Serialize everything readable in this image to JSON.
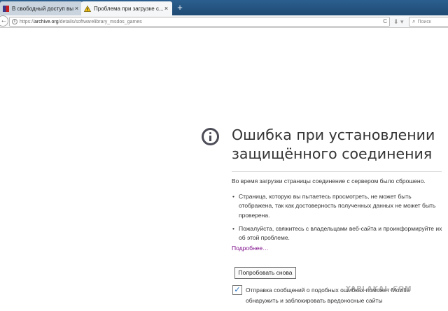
{
  "tabs": [
    {
      "title": "В свободный доступ выл...",
      "active": false,
      "favicon": "site-favicon"
    },
    {
      "title": "Проблема при загрузке с...",
      "active": true,
      "favicon": "warning-icon"
    }
  ],
  "tab_close_glyph": "×",
  "new_tab_glyph": "+",
  "navbar": {
    "back_glyph": "←",
    "url_scheme": "https://",
    "url_host": "archive.org",
    "url_path": "/details/softwarelibrary_msdos_games",
    "reload_glyph": "C",
    "download_glyph": "⬇ ▾",
    "search_placeholder": "Поиск"
  },
  "error": {
    "title_line1": "Ошибка при установлении",
    "title_line2": "защищённого соединения",
    "description": "Во время загрузки страницы соединение с сервером было сброшено.",
    "bullets": [
      "Страница, которую вы пытаетесь просмотреть, не может быть отображена, так как достоверность полученных данных не может быть проверена.",
      "Пожалуйста, свяжитесь с владельцами веб-сайта и проинформируйте их об этой проблеме."
    ],
    "learn_more": "Подробнее…",
    "try_again": "Попробовать снова",
    "report_checked": true,
    "report_text": "Отправка сообщений о подобных ошибках поможет Mozilla обнаружить и заблокировать вредоносные сайты"
  },
  "watermark": "YAPLAKAL.COM",
  "colors": {
    "tabbar": "#1f4a73",
    "link": "#7f0f8a",
    "checkbox_check": "#1c6fbe",
    "icon": "#4c4c57"
  }
}
